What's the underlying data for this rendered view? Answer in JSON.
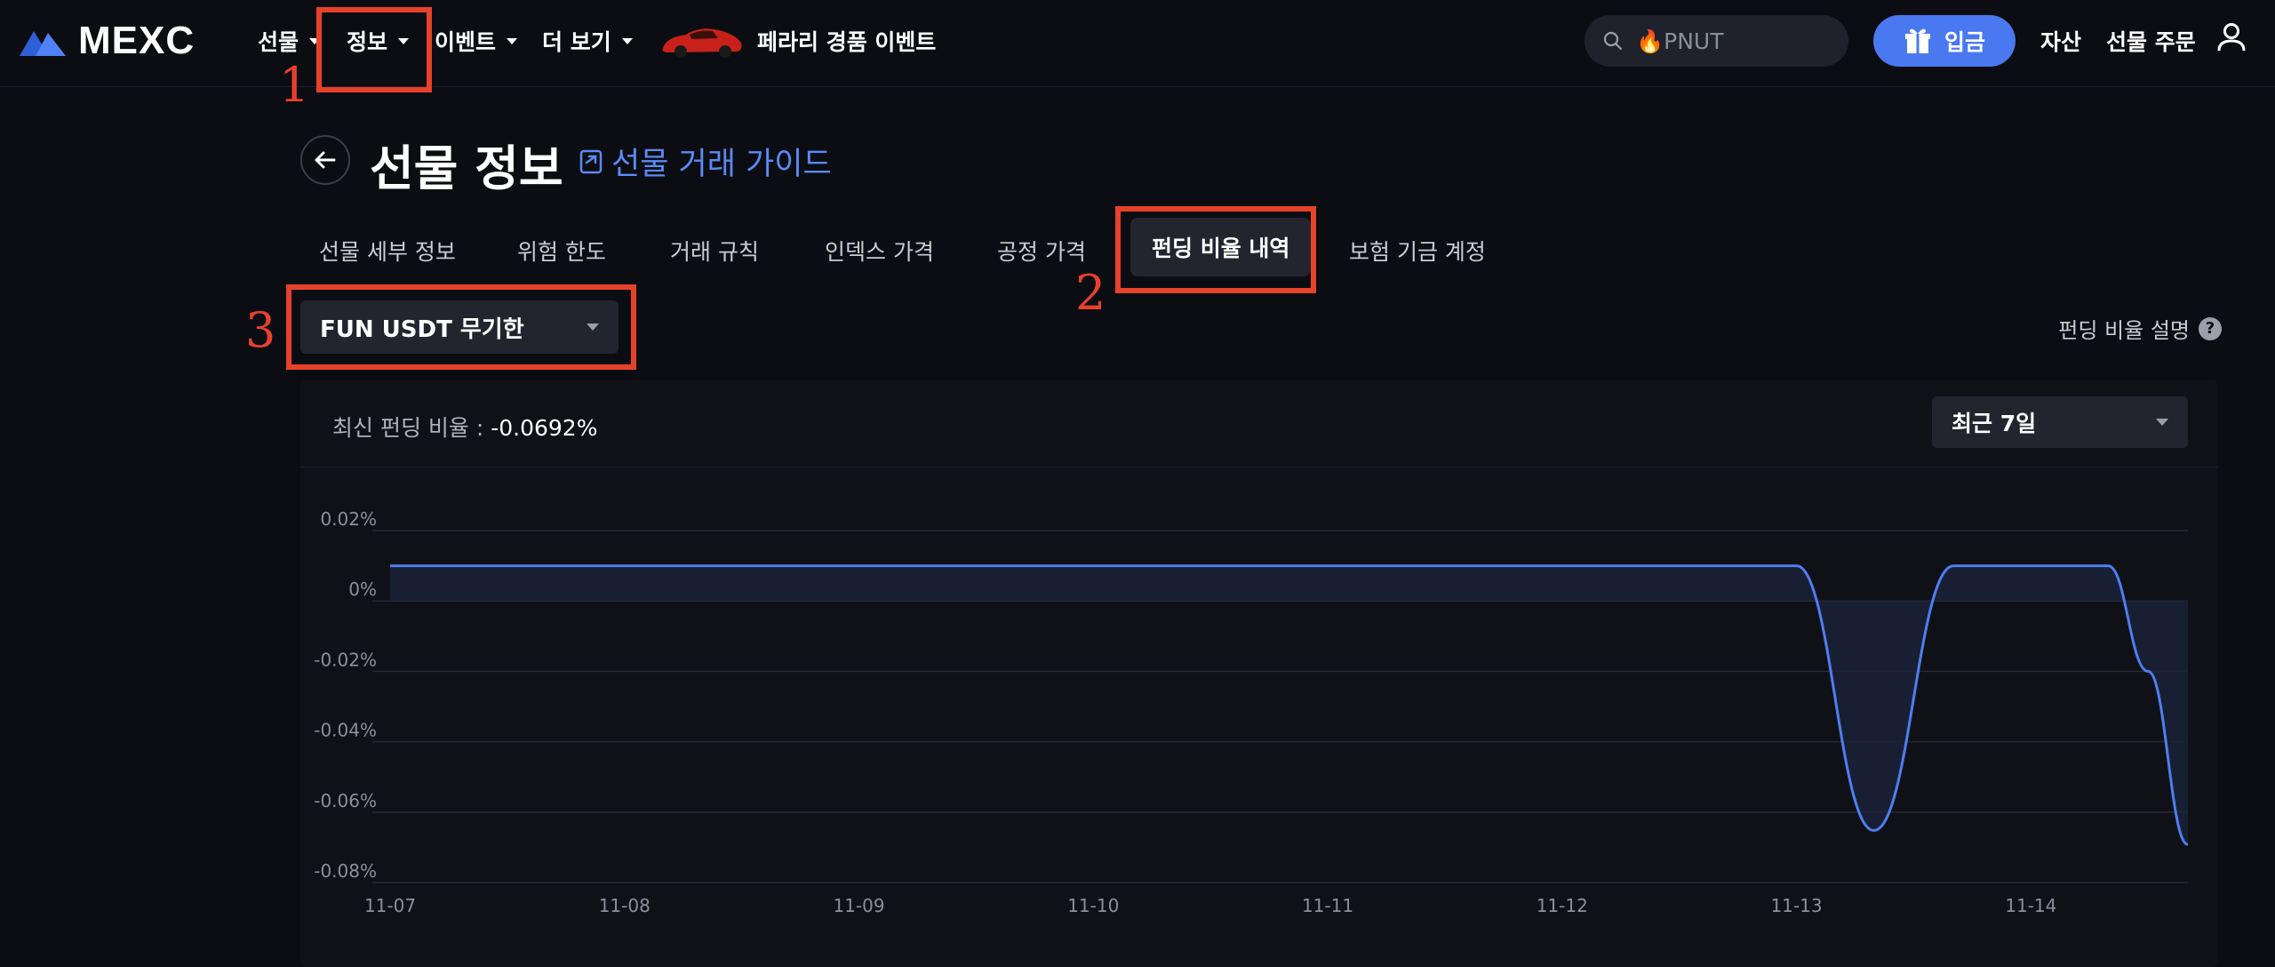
{
  "brand": {
    "name": "MEXC",
    "accent": "#4a78f0",
    "annotation_color": "#e8412b"
  },
  "nav": {
    "items": [
      {
        "label": "선물",
        "has_caret": true
      },
      {
        "label": "정보",
        "has_caret": true
      },
      {
        "label": "이벤트",
        "has_caret": true
      },
      {
        "label": "더 보기",
        "has_caret": true
      }
    ],
    "promo_label": "페라리 경품 이벤트",
    "search_placeholder": "🔥PNUT",
    "deposit_label": "입금",
    "assets_label": "자산",
    "futures_orders_label": "선물 주문"
  },
  "annotations": [
    "1",
    "2",
    "3"
  ],
  "header": {
    "title": "선물 정보",
    "guide_link": "선물 거래 가이드"
  },
  "tabs": [
    {
      "label": "선물 세부 정보",
      "active": false
    },
    {
      "label": "위험 한도",
      "active": false
    },
    {
      "label": "거래 규칙",
      "active": false
    },
    {
      "label": "인덱스 가격",
      "active": false
    },
    {
      "label": "공정 가격",
      "active": false
    },
    {
      "label": "펀딩 비율 내역",
      "active": true
    },
    {
      "label": "보험 기금 계정",
      "active": false
    }
  ],
  "symbol_select": {
    "value": "FUN USDT 무기한"
  },
  "funding_explain": {
    "label": "펀딩 비율 설명"
  },
  "panel": {
    "latest_label": "최신 펀딩 비율 :",
    "latest_value": "-0.0692%",
    "range_select": "최근 7일"
  },
  "chart_data": {
    "type": "area",
    "title": "",
    "xlabel": "",
    "ylabel": "",
    "ylim": [
      -0.08,
      0.02
    ],
    "y_ticks": [
      "0.02%",
      "0%",
      "-0.02%",
      "-0.04%",
      "-0.06%",
      "-0.08%"
    ],
    "y_tick_values": [
      0.02,
      0,
      -0.02,
      -0.04,
      -0.06,
      -0.08
    ],
    "x_ticks": [
      "11-07",
      "11-08",
      "11-09",
      "11-10",
      "11-11",
      "11-12",
      "11-13",
      "11-14"
    ],
    "xlim": [
      0,
      7.67
    ],
    "grid": true,
    "line_color": "#4e7ef0",
    "series": [
      {
        "x": [
          0,
          1,
          2,
          3,
          4,
          5,
          6,
          6.33,
          6.67,
          7,
          7.33,
          7.5,
          7.67
        ],
        "values": [
          0.01,
          0.01,
          0.01,
          0.01,
          0.01,
          0.01,
          0.01,
          -0.0652,
          0.01,
          0.01,
          0.01,
          -0.02,
          -0.0692
        ]
      }
    ]
  }
}
